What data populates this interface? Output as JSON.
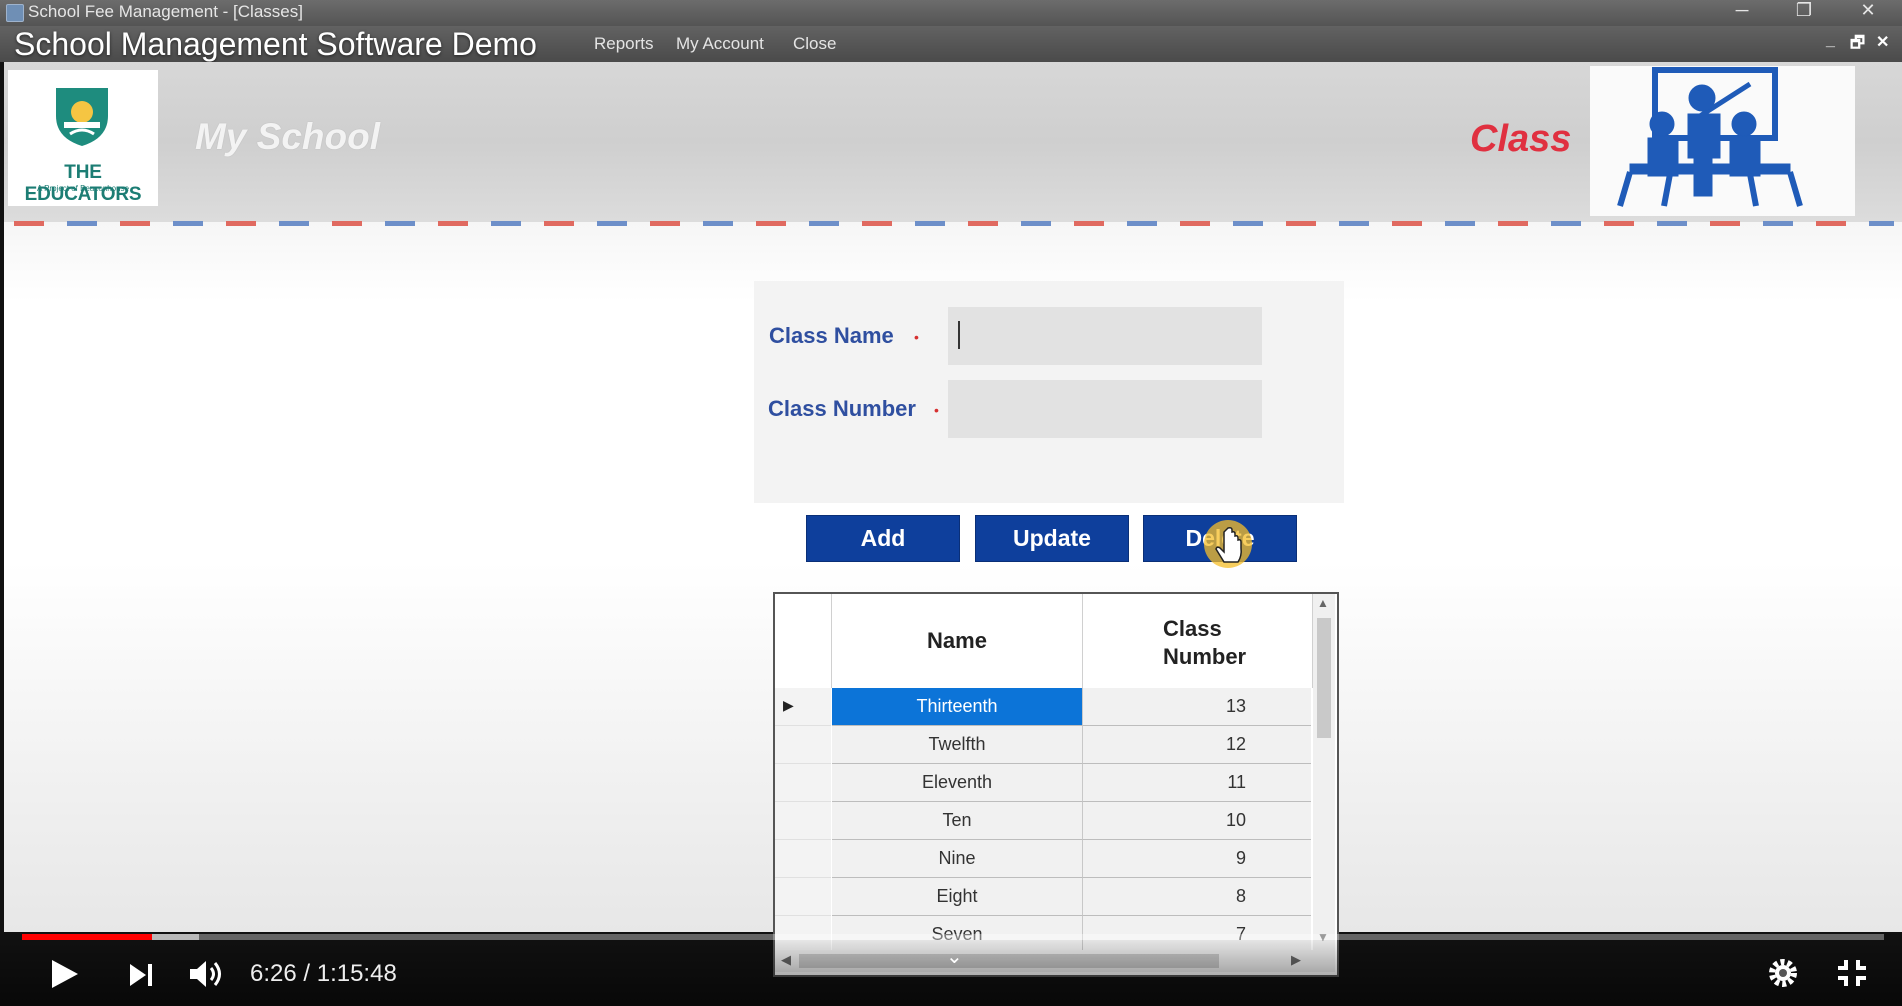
{
  "window": {
    "title": "School Fee Management - [Classes]",
    "buttons": [
      "─",
      "❐",
      "✕"
    ]
  },
  "menubar": {
    "items": [
      "Reports",
      "My Account",
      "Close"
    ],
    "mdi_buttons": [
      "_",
      "🗗",
      "✕"
    ]
  },
  "video": {
    "title": "School Management Software Demo",
    "time": "6:26 / 1:15:48",
    "progress_played": 0.07,
    "progress_buffered": 0.095
  },
  "header": {
    "logo_text": "THE EDUCATORS",
    "logo_sub": "A Project of Beaconhouse",
    "school_name": "My School",
    "page_title": "Class"
  },
  "form": {
    "class_name_label": "Class Name",
    "class_number_label": "Class Number",
    "required_mark": "•",
    "class_name_value": "",
    "class_number_value": ""
  },
  "buttons": {
    "add": "Add",
    "update": "Update",
    "delete": "Delete"
  },
  "grid": {
    "columns": [
      "Name",
      "Class\nNumber"
    ],
    "rows": [
      {
        "name": "Thirteenth",
        "number": "13"
      },
      {
        "name": "Twelfth",
        "number": "12"
      },
      {
        "name": "Eleventh",
        "number": "11"
      },
      {
        "name": "Ten",
        "number": "10"
      },
      {
        "name": "Nine",
        "number": "9"
      },
      {
        "name": "Eight",
        "number": "8"
      },
      {
        "name": "Seven",
        "number": "7"
      }
    ],
    "selected_row": 0
  },
  "colors": {
    "accent_blue": "#0e3f9c",
    "title_red": "#e03040",
    "selection": "#0c74d8",
    "progress_red": "#ff0000"
  }
}
